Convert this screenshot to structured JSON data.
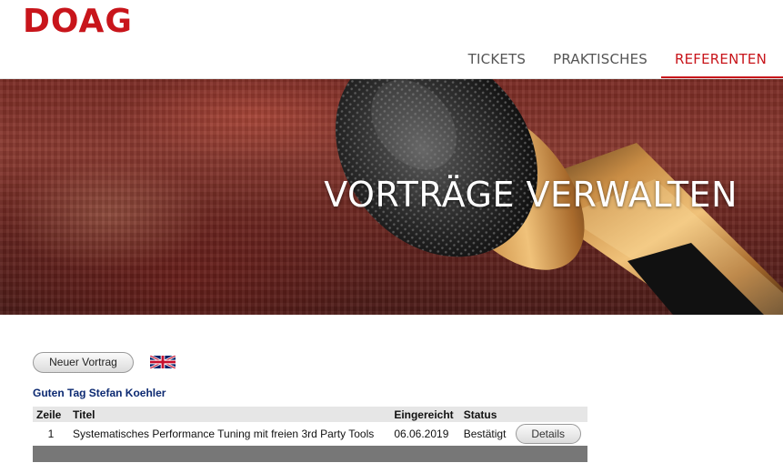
{
  "header": {
    "logo": "DOAG",
    "nav": [
      {
        "label": "TICKETS",
        "active": false
      },
      {
        "label": "PRAKTISCHES",
        "active": false
      },
      {
        "label": "REFERENTEN",
        "active": true
      }
    ]
  },
  "hero": {
    "title": "VORTRÄGE VERWALTEN"
  },
  "actions": {
    "new_talk_label": "Neuer Vortrag",
    "language_flag_icon": "uk-flag-icon"
  },
  "greeting": "Guten Tag Stefan Koehler",
  "table": {
    "headers": {
      "row": "Zeile",
      "title": "Titel",
      "submitted": "Eingereicht",
      "status": "Status"
    },
    "rows": [
      {
        "nr": "1",
        "title": "Systematisches Performance Tuning mit freien 3rd Party Tools",
        "submitted": "06.06.2019",
        "status": "Bestätigt",
        "action": "Details"
      }
    ]
  },
  "colors": {
    "brand_red": "#c8151b",
    "greeting_blue": "#0d2a72",
    "footer_gray": "#777777"
  }
}
